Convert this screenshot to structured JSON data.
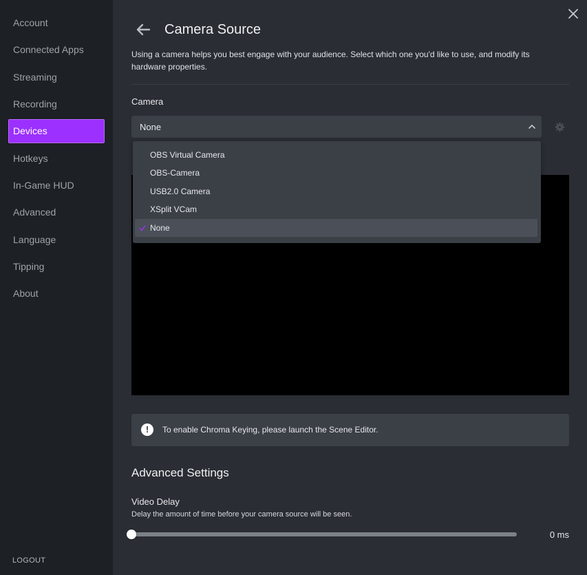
{
  "sidebar": {
    "items": [
      {
        "label": "Account",
        "active": false
      },
      {
        "label": "Connected Apps",
        "active": false
      },
      {
        "label": "Streaming",
        "active": false
      },
      {
        "label": "Recording",
        "active": false
      },
      {
        "label": "Devices",
        "active": true
      },
      {
        "label": "Hotkeys",
        "active": false
      },
      {
        "label": "In-Game HUD",
        "active": false
      },
      {
        "label": "Advanced",
        "active": false
      },
      {
        "label": "Language",
        "active": false
      },
      {
        "label": "Tipping",
        "active": false
      },
      {
        "label": "About",
        "active": false
      }
    ],
    "logout_label": "LOGOUT"
  },
  "header": {
    "title": "Camera Source",
    "description": "Using a camera helps you best engage with your audience. Select which one you'd like to use, and modify its hardware properties."
  },
  "camera": {
    "label": "Camera",
    "selected": "None",
    "options": [
      "OBS Virtual Camera",
      "OBS-Camera",
      "USB2.0 Camera",
      "XSplit VCam",
      "None"
    ],
    "selected_index": 4
  },
  "info": {
    "icon_glyph": "!",
    "text": "To enable Chroma Keying, please launch the Scene Editor."
  },
  "advanced": {
    "title": "Advanced Settings",
    "video_delay": {
      "label": "Video Delay",
      "description": "Delay the amount of time before your camera source will be seen.",
      "value_text": "0 ms",
      "fraction": 0
    }
  },
  "colors": {
    "accent": "#9b30ff",
    "sidebar_bg": "#1d2024",
    "main_bg": "#2a2d33",
    "panel_bg": "#3b3f46"
  }
}
